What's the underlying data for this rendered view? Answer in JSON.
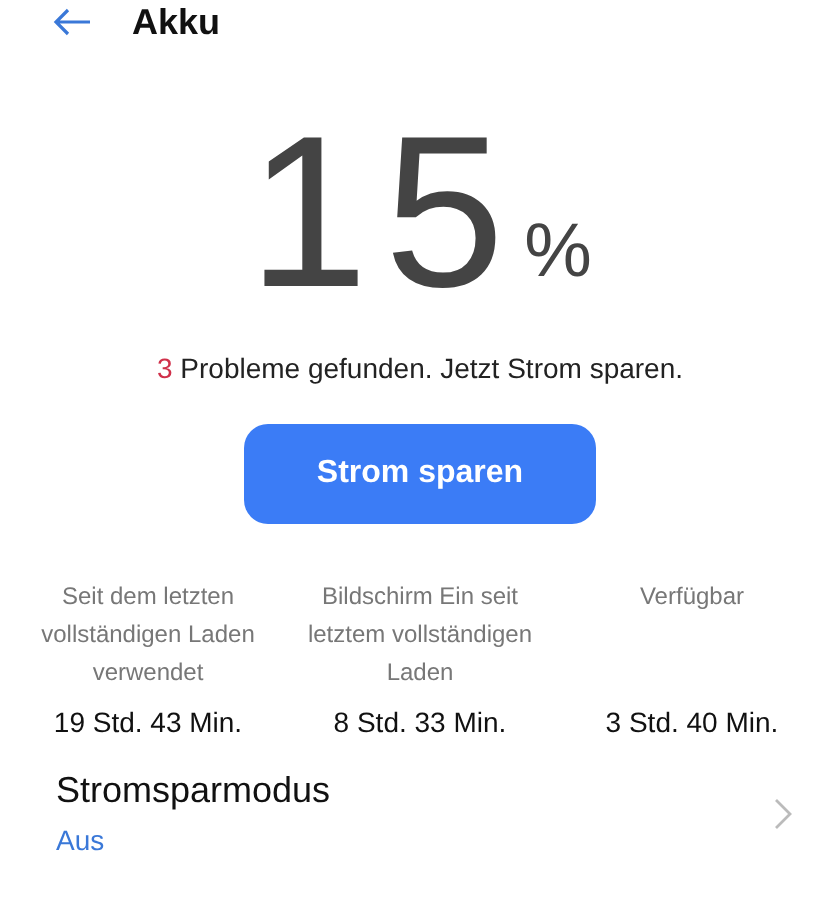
{
  "header": {
    "title": "Akku"
  },
  "battery": {
    "value": "15",
    "unit": "%"
  },
  "issues": {
    "count": "3",
    "message": "Probleme gefunden. Jetzt Strom sparen."
  },
  "action_button": {
    "label": "Strom sparen"
  },
  "stats": [
    {
      "label": "Seit dem letzten vollständigen Laden verwendet",
      "value": "19 Std. 43 Min."
    },
    {
      "label": "Bildschirm Ein seit letztem vollständigen Laden",
      "value": "8 Std. 33 Min."
    },
    {
      "label": "Verfügbar",
      "value": "3 Std. 40 Min."
    }
  ],
  "settings": [
    {
      "title": "Stromsparmodus",
      "status": "Aus"
    }
  ]
}
